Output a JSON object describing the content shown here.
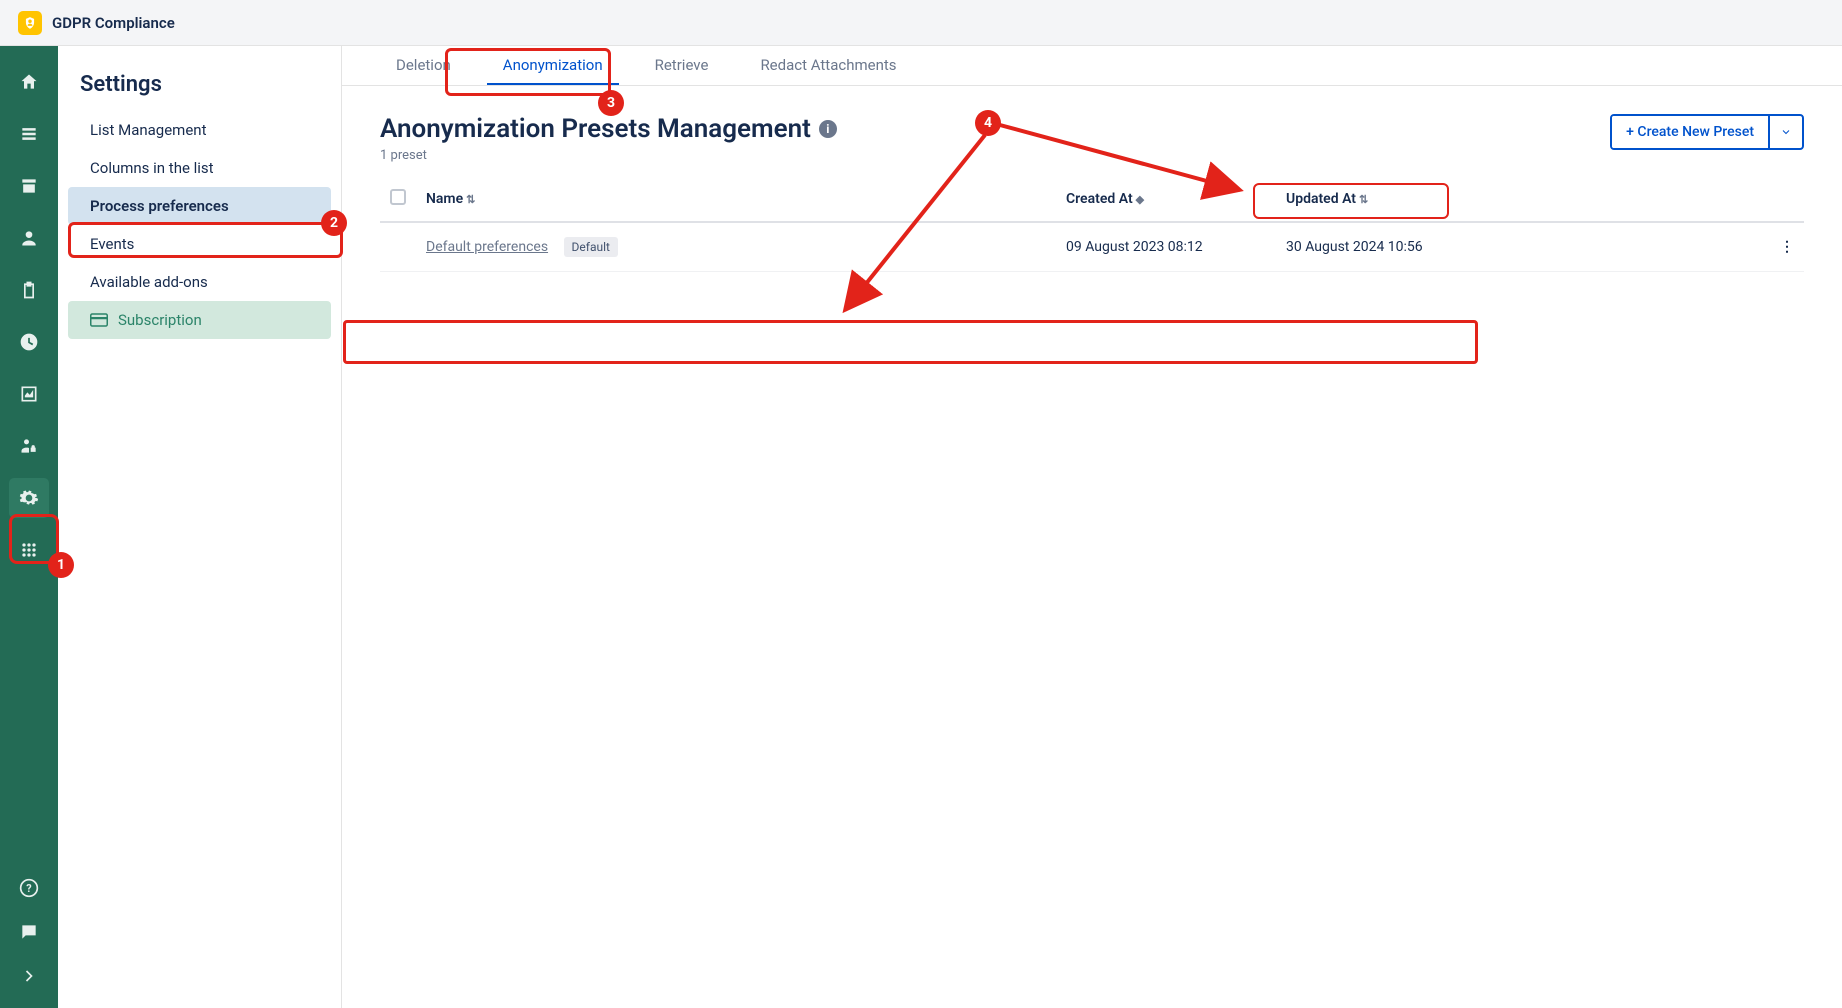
{
  "app": {
    "title": "GDPR Compliance"
  },
  "sidebar": {
    "section_title": "Settings",
    "items": [
      {
        "label": "List Management"
      },
      {
        "label": "Columns in the list"
      },
      {
        "label": "Process preferences"
      },
      {
        "label": "Events"
      },
      {
        "label": "Available add-ons"
      },
      {
        "label": "Subscription"
      }
    ]
  },
  "tabs": [
    {
      "label": "Deletion"
    },
    {
      "label": "Anonymization"
    },
    {
      "label": "Retrieve"
    },
    {
      "label": "Redact Attachments"
    }
  ],
  "page": {
    "title": "Anonymization Presets Management",
    "subtitle": "1 preset",
    "create_label": "+ Create New Preset"
  },
  "table": {
    "headers": {
      "name": "Name",
      "created": "Created At",
      "updated": "Updated At"
    },
    "rows": [
      {
        "name": "Default preferences",
        "badge": "Default",
        "created": "09 August 2023 08:12",
        "updated": "30 August 2024 10:56"
      }
    ]
  },
  "annotations": {
    "badge1": "1",
    "badge2": "2",
    "badge3": "3",
    "badge4": "4"
  }
}
